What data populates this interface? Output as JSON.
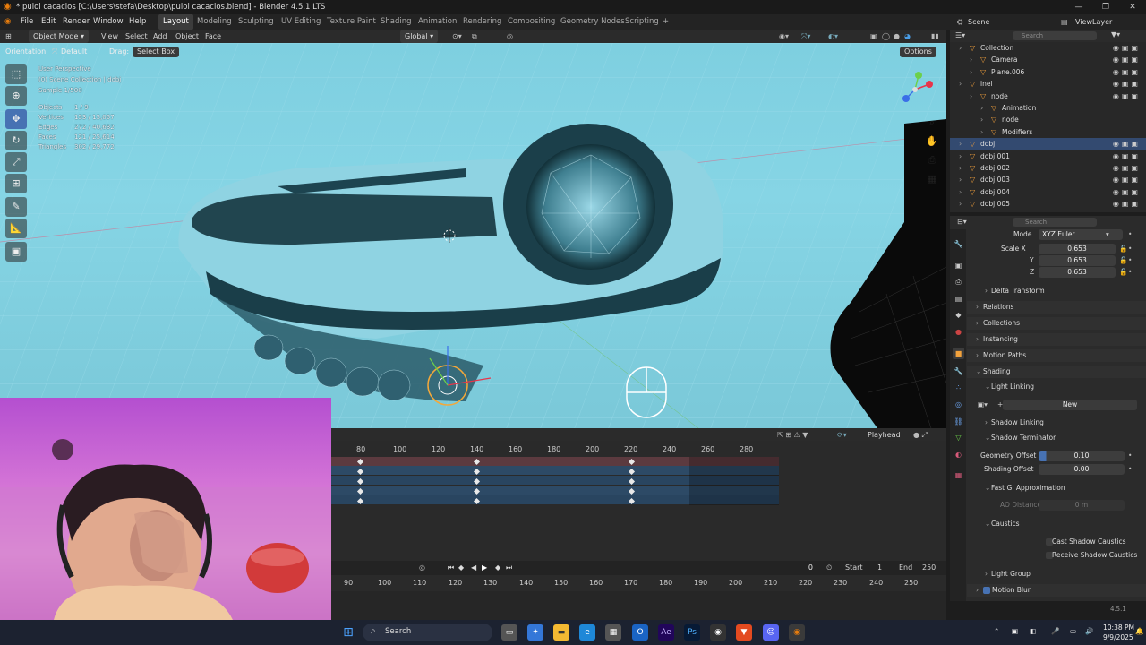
{
  "window": {
    "title": "* puloi cacacios [C:\\Users\\stefa\\Desktop\\puloi cacacios.blend] - Blender 4.5.1 LTS"
  },
  "menu": [
    "File",
    "Edit",
    "Render",
    "Window",
    "Help"
  ],
  "workspaces": {
    "active": "Layout",
    "others": [
      "Modeling",
      "Sculpting",
      "UV Editing",
      "Texture Paint",
      "Shading",
      "Animation",
      "Rendering",
      "Compositing",
      "Geometry Nodes",
      "Scripting"
    ]
  },
  "scene": {
    "scene_name": "Scene",
    "view_layer": "ViewLayer"
  },
  "header3d": {
    "mode": "Object Mode",
    "menus": [
      "View",
      "Select",
      "Add",
      "Object",
      "Face"
    ],
    "transform_orientation": "Global"
  },
  "toolbar": {
    "orientation_label": "Orientation:",
    "orientation_value": "Default",
    "drag_label": "Drag:",
    "drag_value": "Select Box",
    "options": "Options"
  },
  "viewport_info": {
    "line1": "User Perspective",
    "line2": "(0) Scene Collection | dobj",
    "line3": "Sample 1/500",
    "stats": [
      {
        "label": "Objects",
        "value": "1 / 9"
      },
      {
        "label": "Vertices",
        "value": "153 / 15,057"
      },
      {
        "label": "Edges",
        "value": "272 / 40,632"
      },
      {
        "label": "Faces",
        "value": "121 / 25,614"
      },
      {
        "label": "Triangles",
        "value": "302 / 29,772"
      }
    ]
  },
  "timeline": {
    "frame_numbers": [
      "80",
      "100",
      "120",
      "140",
      "160",
      "180",
      "200",
      "220",
      "240",
      "260",
      "280"
    ],
    "playhead_label": "Playhead",
    "current_frame": "0",
    "start_label": "Start",
    "start": "1",
    "end_label": "End",
    "end": "250",
    "lower_numbers": [
      "90",
      "100",
      "110",
      "120",
      "130",
      "140",
      "150",
      "160",
      "170",
      "180",
      "190",
      "200",
      "210",
      "220",
      "230",
      "240",
      "250"
    ]
  },
  "outliner": {
    "search_placeholder": "Search",
    "rows": [
      {
        "label": "Collection",
        "indent": 1
      },
      {
        "label": "Camera",
        "indent": 2
      },
      {
        "label": "Plane.006",
        "indent": 2
      },
      {
        "label": "inel",
        "indent": 1
      },
      {
        "label": "node",
        "indent": 2
      },
      {
        "label": "Animation",
        "indent": 3
      },
      {
        "label": "node",
        "indent": 3
      },
      {
        "label": "Modifiers",
        "indent": 3
      },
      {
        "label": "dobj",
        "indent": 1,
        "selected": true
      },
      {
        "label": "dobj.001",
        "indent": 1
      },
      {
        "label": "dobj.002",
        "indent": 1
      },
      {
        "label": "dobj.003",
        "indent": 1
      },
      {
        "label": "dobj.004",
        "indent": 1
      },
      {
        "label": "dobj.005",
        "indent": 1
      }
    ]
  },
  "properties": {
    "search_placeholder": "Search",
    "mode_label": "Mode",
    "mode_value": "XYZ Euler",
    "scale_x_label": "Scale X",
    "scale_x": "0.653",
    "scale_y_label": "Y",
    "scale_y": "0.653",
    "scale_z_label": "Z",
    "scale_z": "0.653",
    "delta_transform": "Delta Transform",
    "relations": "Relations",
    "collections": "Collections",
    "instancing": "Instancing",
    "motion_paths": "Motion Paths",
    "shading": "Shading",
    "light_linking": "Light Linking",
    "new_button": "New",
    "shadow_linking": "Shadow Linking",
    "shadow_terminator": "Shadow Terminator",
    "geometry_offset_label": "Geometry Offset",
    "geometry_offset": "0.10",
    "shading_offset_label": "Shading Offset",
    "shading_offset": "0.00",
    "fast_gi": "Fast GI Approximation",
    "ao_distance_label": "AO Distance",
    "ao_distance": "0 m",
    "caustics": "Caustics",
    "cast_shadow_caustics": "Cast Shadow Caustics",
    "receive_shadow_caustics": "Receive Shadow Caustics",
    "light_group": "Light Group",
    "motion_blur": "Motion Blur",
    "version": "4.5.1"
  },
  "taskbar": {
    "search_label": "Search",
    "time": "10:38 PM",
    "date": "9/9/2025"
  },
  "colors": {
    "accent": "#4772b3",
    "viewport_bg": "#86d5e5",
    "selected_row": "#334a70"
  }
}
